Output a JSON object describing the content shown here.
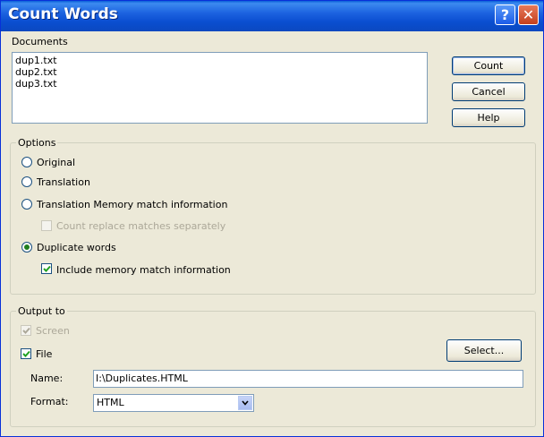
{
  "window": {
    "title": "Count Words"
  },
  "documents": {
    "label": "Documents",
    "items": [
      "dup1.txt",
      "dup2.txt",
      "dup3.txt"
    ]
  },
  "buttons": {
    "count": "Count",
    "cancel": "Cancel",
    "help": "Help",
    "select": "Select..."
  },
  "options": {
    "label": "Options",
    "original": "Original",
    "translation": "Translation",
    "tm_match": "Translation Memory match information",
    "count_replace": "Count replace matches separately",
    "duplicate_words": "Duplicate words",
    "include_memory": "Include memory match information",
    "selected": "Duplicate words"
  },
  "output": {
    "label": "Output to",
    "screen": "Screen",
    "file": "File",
    "name_label": "Name:",
    "name_value": "I:\\Duplicates.HTML",
    "format_label": "Format:",
    "format_value": "HTML"
  }
}
